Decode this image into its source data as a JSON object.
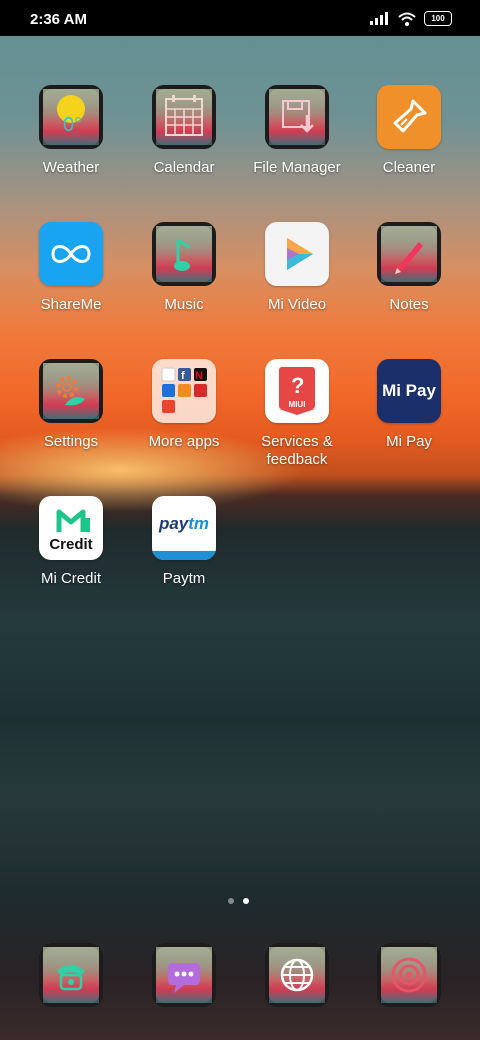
{
  "status_bar": {
    "time": "2:36 AM",
    "battery": "100"
  },
  "apps": [
    {
      "label": "Weather"
    },
    {
      "label": "Calendar"
    },
    {
      "label": "File Manager"
    },
    {
      "label": "Cleaner"
    },
    {
      "label": "ShareMe"
    },
    {
      "label": "Music"
    },
    {
      "label": "Mi Video"
    },
    {
      "label": "Notes"
    },
    {
      "label": "Settings"
    },
    {
      "label": "More apps"
    },
    {
      "label": "Services & feedback"
    },
    {
      "label": "Mi Pay"
    },
    {
      "label": "Mi Credit"
    },
    {
      "label": "Paytm"
    }
  ],
  "icon_text": {
    "services": "MIUI",
    "mipay": "Mi Pay",
    "micredit": "Credit",
    "paytm_pay": "pay",
    "paytm_tm": "tm"
  },
  "page_indicator": {
    "total": 2,
    "current": 2
  },
  "dock": [
    {
      "icon": "phone-icon"
    },
    {
      "icon": "messaging-icon"
    },
    {
      "icon": "browser-icon"
    },
    {
      "icon": "camera-icon"
    }
  ],
  "colors": {
    "cleaner": "#f0902a",
    "shareme": "#19a4f2",
    "mipay": "#1b2f6b",
    "micredit": "#1fc48a",
    "paytm_blue": "#1f8fd6",
    "paytm_navy": "#1f3b73"
  }
}
